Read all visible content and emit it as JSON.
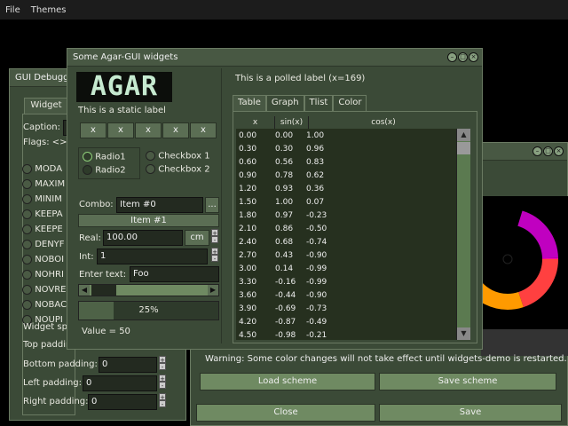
{
  "menubar": {
    "file": "File",
    "themes": "Themes"
  },
  "debugger": {
    "title": "GUI Debugger",
    "tab": "Widget",
    "caption_label": "Caption:",
    "flags_label": "Flags: <>",
    "flags": [
      "MODA",
      "MAXIM",
      "MINIM",
      "KEEPA",
      "KEEPE",
      "DENYF",
      "NOBOI",
      "NOHRI",
      "NOVRE",
      "NOBAC",
      "NOUPI"
    ],
    "widget_spacing_label": "Widget spa",
    "top_padding_label": "Top paddin",
    "bottom_padding_label": "Bottom padding:",
    "bottom_padding_value": "0",
    "left_padding_label": "Left padding:",
    "left_padding_value": "0",
    "right_padding_label": "Right padding:",
    "right_padding_value": "0"
  },
  "main": {
    "title": "Some Agar-GUI widgets",
    "logo": "AGAR",
    "static_label": "This is a static label",
    "x_buttons": [
      "x",
      "x",
      "x",
      "x",
      "x"
    ],
    "radio1": "Radio1",
    "radio2": "Radio2",
    "checkbox1": "Checkbox 1",
    "checkbox2": "Checkbox 2",
    "combo_label": "Combo:",
    "combo_value": "Item #0",
    "combo_btn": "...",
    "item1_button": "Item #1",
    "real_label": "Real:",
    "real_value": "100.00",
    "real_unit": "cm",
    "int_label": "Int:",
    "int_value": "1",
    "enter_text_label": "Enter text:",
    "enter_text_value": "Foo",
    "progress_text": "25%",
    "progress_fraction": 0.25,
    "value_label": "Value = 50",
    "polled_label": "This is a polled label (x=169)",
    "tabs": [
      "Table",
      "Graph",
      "Tlist",
      "Color"
    ],
    "table_headers": [
      "x",
      "sin(x)",
      "cos(x)"
    ],
    "table_rows": [
      [
        "0.00",
        "0.00",
        "1.00"
      ],
      [
        "0.30",
        "0.30",
        "0.96"
      ],
      [
        "0.60",
        "0.56",
        "0.83"
      ],
      [
        "0.90",
        "0.78",
        "0.62"
      ],
      [
        "1.20",
        "0.93",
        "0.36"
      ],
      [
        "1.50",
        "1.00",
        "0.07"
      ],
      [
        "1.80",
        "0.97",
        "-0.23"
      ],
      [
        "2.10",
        "0.86",
        "-0.50"
      ],
      [
        "2.40",
        "0.68",
        "-0.74"
      ],
      [
        "2.70",
        "0.43",
        "-0.90"
      ],
      [
        "3.00",
        "0.14",
        "-0.99"
      ],
      [
        "3.30",
        "-0.16",
        "-0.99"
      ],
      [
        "3.60",
        "-0.44",
        "-0.90"
      ],
      [
        "3.90",
        "-0.69",
        "-0.73"
      ],
      [
        "4.20",
        "-0.87",
        "-0.49"
      ],
      [
        "4.50",
        "-0.98",
        "-0.21"
      ]
    ]
  },
  "theme": {
    "warning": "Warning: Some color changes will not take effect until widgets-demo is restarted.",
    "load_scheme": "Load scheme",
    "save_scheme": "Save scheme",
    "close": "Close",
    "save": "Save"
  },
  "colors": {
    "window_bg": "#3b4a37",
    "accent": "#6f8a62"
  }
}
